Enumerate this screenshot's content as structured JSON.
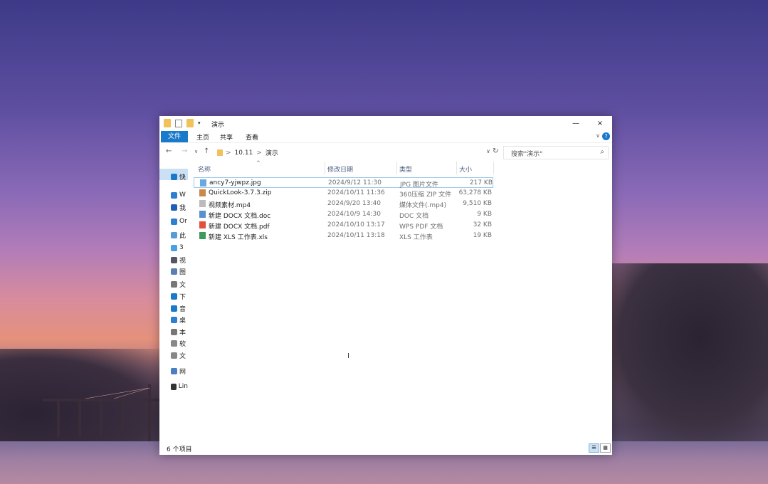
{
  "window": {
    "title": "演示",
    "minimize": "—",
    "close": "×"
  },
  "ribbon": {
    "file": "文件",
    "tabs": [
      "主页",
      "共享",
      "查看"
    ],
    "expand": "∨",
    "help": "?"
  },
  "nav": {
    "back": "←",
    "forward": "→",
    "recent": "∨",
    "up": "↑",
    "path": [
      "10.11",
      "演示"
    ],
    "sep": ">",
    "dropdown": "∨",
    "refresh": "↻",
    "search_placeholder": "搜索\"演示\"",
    "search_icon": "⌕"
  },
  "sidebar": {
    "items": [
      {
        "label": "快",
        "icon": "quick-access-icon",
        "color": "#1979ca"
      },
      {
        "label": "W",
        "icon": "cloud-icon",
        "color": "#2f7fd1"
      },
      {
        "label": "我",
        "icon": "cloud-icon",
        "color": "#1f5fb5"
      },
      {
        "label": "Or",
        "icon": "onedrive-icon",
        "color": "#2f7fd1"
      },
      {
        "label": "此",
        "icon": "pc-icon",
        "color": "#5b9bd5"
      },
      {
        "label": "3",
        "icon": "3d-objects-icon",
        "color": "#4aa0e0"
      },
      {
        "label": "视",
        "icon": "video-icon",
        "color": "#556"
      },
      {
        "label": "图",
        "icon": "pictures-icon",
        "color": "#5a7fb0"
      },
      {
        "label": "文",
        "icon": "documents-icon",
        "color": "#777"
      },
      {
        "label": "下",
        "icon": "download-icon",
        "color": "#1979ca"
      },
      {
        "label": "音",
        "icon": "music-icon",
        "color": "#1979ca"
      },
      {
        "label": "桌",
        "icon": "desktop-icon",
        "color": "#2f7fd1"
      },
      {
        "label": "本",
        "icon": "drive-icon",
        "color": "#777"
      },
      {
        "label": "软",
        "icon": "drive-icon",
        "color": "#888"
      },
      {
        "label": "文",
        "icon": "drive-icon",
        "color": "#888"
      },
      {
        "label": "网",
        "icon": "network-icon",
        "color": "#4a7fc0"
      },
      {
        "label": "Lin",
        "icon": "linux-icon",
        "color": "#333"
      }
    ]
  },
  "columns": {
    "name": "名称",
    "date": "修改日期",
    "type": "类型",
    "size": "大小",
    "sort": "^"
  },
  "files": [
    {
      "name": "ancy7-yjwpz.jpg",
      "date": "2024/9/12 11:30",
      "type": "JPG 图片文件",
      "size": "217 KB",
      "icon": "image-file-icon",
      "color": "#6aa9e0"
    },
    {
      "name": "QuickLook-3.7.3.zip",
      "date": "2024/10/11 11:36",
      "type": "360压缩 ZIP 文件",
      "size": "63,278 KB",
      "icon": "zip-file-icon",
      "color": "#c8894a"
    },
    {
      "name": "视频素材.mp4",
      "date": "2024/9/20 13:40",
      "type": "媒体文件(.mp4)",
      "size": "9,510 KB",
      "icon": "video-file-icon",
      "color": "#bbbbbb"
    },
    {
      "name": "新建 DOCX 文档.doc",
      "date": "2024/10/9 14:30",
      "type": "DOC 文档",
      "size": "9 KB",
      "icon": "word-file-icon",
      "color": "#5a8fd0"
    },
    {
      "name": "新建 DOCX 文档.pdf",
      "date": "2024/10/10 13:17",
      "type": "WPS PDF 文档",
      "size": "32 KB",
      "icon": "pdf-file-icon",
      "color": "#e0503c"
    },
    {
      "name": "新建 XLS 工作表.xls",
      "date": "2024/10/11 13:18",
      "type": "XLS 工作表",
      "size": "19 KB",
      "icon": "excel-file-icon",
      "color": "#3e9a5a"
    }
  ],
  "status": "6 个项目",
  "views": [
    "details-view-icon",
    "large-icons-view-icon"
  ]
}
